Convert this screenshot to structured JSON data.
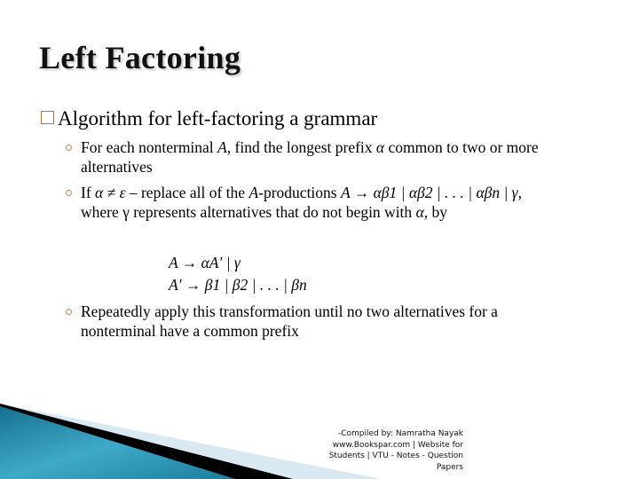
{
  "slide": {
    "title": "Left Factoring",
    "main_bullet": "Algorithm for left-factoring a grammar",
    "sub_bullets": [
      {
        "pre": "For each nonterminal ",
        "var1": "A,",
        "mid": " find the longest prefix ",
        "var2": "α",
        "post": " common to two or more",
        "line2": "alternatives"
      },
      {
        "pre": "If ",
        "cond": "α ≠ ε",
        "mid": " – replace all of the ",
        "var": "A",
        "mid2": "-productions ",
        "prod": "A → αβ1 | αβ2 | . . . | αβn |  γ,",
        "line2_pre": "where γ represents alternatives that do not begin with ",
        "line2_var": "α,",
        "line2_post": " by"
      },
      {
        "text": "Repeatedly apply this transformation until no two alternatives for a",
        "line2": "nonterminal have a common prefix"
      }
    ],
    "formulas": [
      "A → αA′ | γ",
      "A′ → β1 | β2 | . . . | βn"
    ],
    "credit": [
      "-Compiled by: Namratha Nayak",
      "www.Bookspar.com | Website for",
      "Students | VTU - Notes - Question",
      "Papers"
    ],
    "colors": {
      "bullet": "#b07a50",
      "teal": "#1f8fb0",
      "light_band": "#d6e8f0"
    }
  }
}
